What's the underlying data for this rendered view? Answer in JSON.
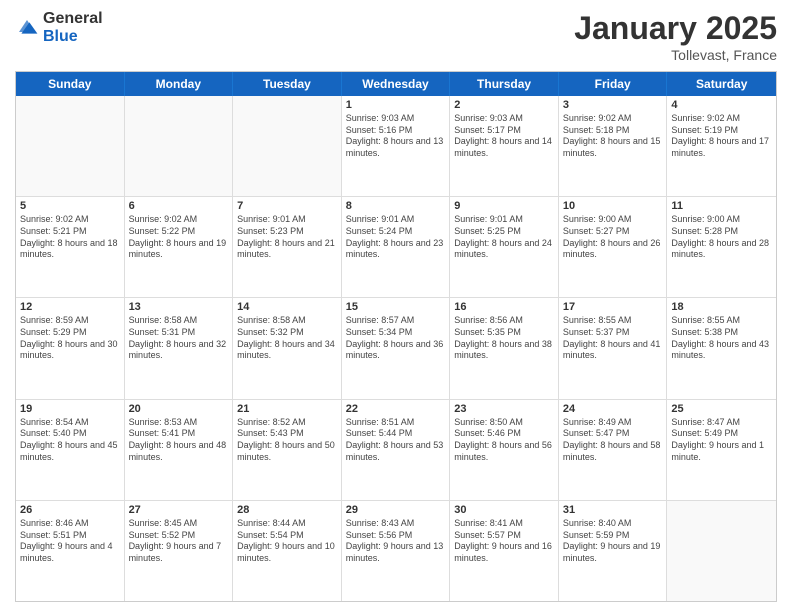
{
  "logo": {
    "general": "General",
    "blue": "Blue"
  },
  "header": {
    "title": "January 2025",
    "location": "Tollevast, France"
  },
  "weekdays": [
    "Sunday",
    "Monday",
    "Tuesday",
    "Wednesday",
    "Thursday",
    "Friday",
    "Saturday"
  ],
  "weeks": [
    [
      {
        "day": "",
        "sunrise": "",
        "sunset": "",
        "daylight": ""
      },
      {
        "day": "",
        "sunrise": "",
        "sunset": "",
        "daylight": ""
      },
      {
        "day": "",
        "sunrise": "",
        "sunset": "",
        "daylight": ""
      },
      {
        "day": "1",
        "sunrise": "Sunrise: 9:03 AM",
        "sunset": "Sunset: 5:16 PM",
        "daylight": "Daylight: 8 hours and 13 minutes."
      },
      {
        "day": "2",
        "sunrise": "Sunrise: 9:03 AM",
        "sunset": "Sunset: 5:17 PM",
        "daylight": "Daylight: 8 hours and 14 minutes."
      },
      {
        "day": "3",
        "sunrise": "Sunrise: 9:02 AM",
        "sunset": "Sunset: 5:18 PM",
        "daylight": "Daylight: 8 hours and 15 minutes."
      },
      {
        "day": "4",
        "sunrise": "Sunrise: 9:02 AM",
        "sunset": "Sunset: 5:19 PM",
        "daylight": "Daylight: 8 hours and 17 minutes."
      }
    ],
    [
      {
        "day": "5",
        "sunrise": "Sunrise: 9:02 AM",
        "sunset": "Sunset: 5:21 PM",
        "daylight": "Daylight: 8 hours and 18 minutes."
      },
      {
        "day": "6",
        "sunrise": "Sunrise: 9:02 AM",
        "sunset": "Sunset: 5:22 PM",
        "daylight": "Daylight: 8 hours and 19 minutes."
      },
      {
        "day": "7",
        "sunrise": "Sunrise: 9:01 AM",
        "sunset": "Sunset: 5:23 PM",
        "daylight": "Daylight: 8 hours and 21 minutes."
      },
      {
        "day": "8",
        "sunrise": "Sunrise: 9:01 AM",
        "sunset": "Sunset: 5:24 PM",
        "daylight": "Daylight: 8 hours and 23 minutes."
      },
      {
        "day": "9",
        "sunrise": "Sunrise: 9:01 AM",
        "sunset": "Sunset: 5:25 PM",
        "daylight": "Daylight: 8 hours and 24 minutes."
      },
      {
        "day": "10",
        "sunrise": "Sunrise: 9:00 AM",
        "sunset": "Sunset: 5:27 PM",
        "daylight": "Daylight: 8 hours and 26 minutes."
      },
      {
        "day": "11",
        "sunrise": "Sunrise: 9:00 AM",
        "sunset": "Sunset: 5:28 PM",
        "daylight": "Daylight: 8 hours and 28 minutes."
      }
    ],
    [
      {
        "day": "12",
        "sunrise": "Sunrise: 8:59 AM",
        "sunset": "Sunset: 5:29 PM",
        "daylight": "Daylight: 8 hours and 30 minutes."
      },
      {
        "day": "13",
        "sunrise": "Sunrise: 8:58 AM",
        "sunset": "Sunset: 5:31 PM",
        "daylight": "Daylight: 8 hours and 32 minutes."
      },
      {
        "day": "14",
        "sunrise": "Sunrise: 8:58 AM",
        "sunset": "Sunset: 5:32 PM",
        "daylight": "Daylight: 8 hours and 34 minutes."
      },
      {
        "day": "15",
        "sunrise": "Sunrise: 8:57 AM",
        "sunset": "Sunset: 5:34 PM",
        "daylight": "Daylight: 8 hours and 36 minutes."
      },
      {
        "day": "16",
        "sunrise": "Sunrise: 8:56 AM",
        "sunset": "Sunset: 5:35 PM",
        "daylight": "Daylight: 8 hours and 38 minutes."
      },
      {
        "day": "17",
        "sunrise": "Sunrise: 8:55 AM",
        "sunset": "Sunset: 5:37 PM",
        "daylight": "Daylight: 8 hours and 41 minutes."
      },
      {
        "day": "18",
        "sunrise": "Sunrise: 8:55 AM",
        "sunset": "Sunset: 5:38 PM",
        "daylight": "Daylight: 8 hours and 43 minutes."
      }
    ],
    [
      {
        "day": "19",
        "sunrise": "Sunrise: 8:54 AM",
        "sunset": "Sunset: 5:40 PM",
        "daylight": "Daylight: 8 hours and 45 minutes."
      },
      {
        "day": "20",
        "sunrise": "Sunrise: 8:53 AM",
        "sunset": "Sunset: 5:41 PM",
        "daylight": "Daylight: 8 hours and 48 minutes."
      },
      {
        "day": "21",
        "sunrise": "Sunrise: 8:52 AM",
        "sunset": "Sunset: 5:43 PM",
        "daylight": "Daylight: 8 hours and 50 minutes."
      },
      {
        "day": "22",
        "sunrise": "Sunrise: 8:51 AM",
        "sunset": "Sunset: 5:44 PM",
        "daylight": "Daylight: 8 hours and 53 minutes."
      },
      {
        "day": "23",
        "sunrise": "Sunrise: 8:50 AM",
        "sunset": "Sunset: 5:46 PM",
        "daylight": "Daylight: 8 hours and 56 minutes."
      },
      {
        "day": "24",
        "sunrise": "Sunrise: 8:49 AM",
        "sunset": "Sunset: 5:47 PM",
        "daylight": "Daylight: 8 hours and 58 minutes."
      },
      {
        "day": "25",
        "sunrise": "Sunrise: 8:47 AM",
        "sunset": "Sunset: 5:49 PM",
        "daylight": "Daylight: 9 hours and 1 minute."
      }
    ],
    [
      {
        "day": "26",
        "sunrise": "Sunrise: 8:46 AM",
        "sunset": "Sunset: 5:51 PM",
        "daylight": "Daylight: 9 hours and 4 minutes."
      },
      {
        "day": "27",
        "sunrise": "Sunrise: 8:45 AM",
        "sunset": "Sunset: 5:52 PM",
        "daylight": "Daylight: 9 hours and 7 minutes."
      },
      {
        "day": "28",
        "sunrise": "Sunrise: 8:44 AM",
        "sunset": "Sunset: 5:54 PM",
        "daylight": "Daylight: 9 hours and 10 minutes."
      },
      {
        "day": "29",
        "sunrise": "Sunrise: 8:43 AM",
        "sunset": "Sunset: 5:56 PM",
        "daylight": "Daylight: 9 hours and 13 minutes."
      },
      {
        "day": "30",
        "sunrise": "Sunrise: 8:41 AM",
        "sunset": "Sunset: 5:57 PM",
        "daylight": "Daylight: 9 hours and 16 minutes."
      },
      {
        "day": "31",
        "sunrise": "Sunrise: 8:40 AM",
        "sunset": "Sunset: 5:59 PM",
        "daylight": "Daylight: 9 hours and 19 minutes."
      },
      {
        "day": "",
        "sunrise": "",
        "sunset": "",
        "daylight": ""
      }
    ]
  ]
}
